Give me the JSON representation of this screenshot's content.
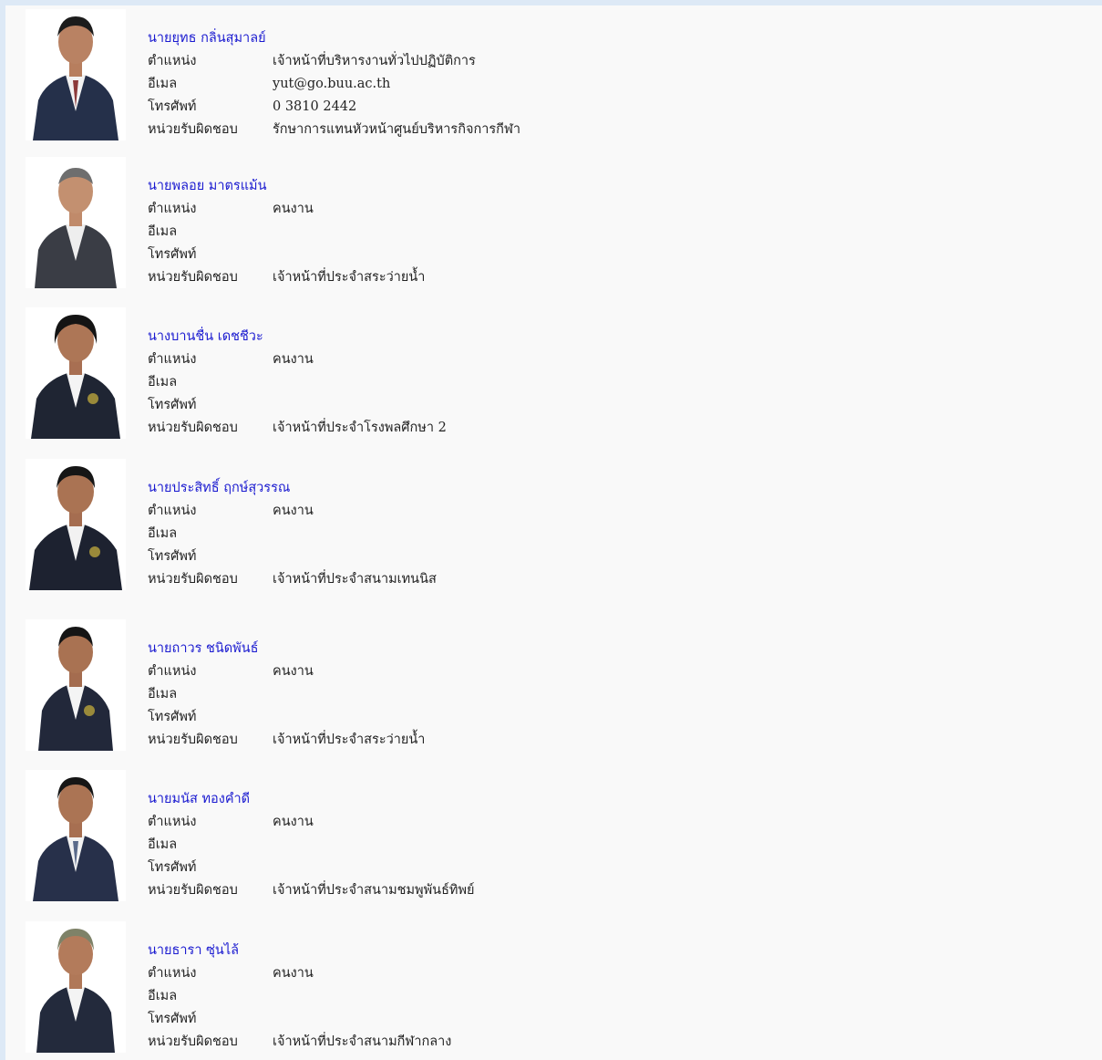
{
  "labels": {
    "position": "ตำแหน่ง",
    "email": "อีเมล",
    "phone": "โทรศัพท์",
    "unit": "หน่วยรับผิดชอบ"
  },
  "colors": {
    "name_link": "#1a1ad0",
    "text": "#222222",
    "page_bg": "#f9f9f9",
    "outer_bg": "#dde9f6",
    "suit": "#25304a"
  },
  "staff": [
    {
      "name": "นายยุทธ กลิ่นสุมาลย์",
      "position": "เจ้าหน้าที่บริหารงานทั่วไปปฏิบัติการ",
      "email": "yut@go.buu.ac.th",
      "phone": "0 3810 2442",
      "unit": "รักษาการแทนหัวหน้าศูนย์บริหารกิจการกีฬา",
      "photo_icon": "person-portrait-icon"
    },
    {
      "name": "นายพลอย มาตรแม้น",
      "position": "คนงาน",
      "email": "",
      "phone": "",
      "unit": "เจ้าหน้าที่ประจำสระว่ายน้ำ",
      "photo_icon": "person-portrait-icon"
    },
    {
      "name": "นางบานชื่น เดชชีวะ",
      "position": "คนงาน",
      "email": "",
      "phone": "",
      "unit": "เจ้าหน้าที่ประจำโรงพลศึกษา 2",
      "photo_icon": "person-portrait-icon"
    },
    {
      "name": "นายประสิทธิ์ ฤกษ์สุวรรณ",
      "position": "คนงาน",
      "email": "",
      "phone": "",
      "unit": "เจ้าหน้าที่ประจำสนามเทนนิส",
      "photo_icon": "person-portrait-icon"
    },
    {
      "name": "นายถาวร ชนิดพันธ์",
      "position": "คนงาน",
      "email": "",
      "phone": "",
      "unit": "เจ้าหน้าที่ประจำสระว่ายน้ำ",
      "photo_icon": "person-portrait-icon"
    },
    {
      "name": "นายมนัส ทองคำดี",
      "position": "คนงาน",
      "email": "",
      "phone": "",
      "unit": "เจ้าหน้าที่ประจำสนามชมพูพันธ์ทิพย์",
      "photo_icon": "person-portrait-icon"
    },
    {
      "name": "นายธารา ซุ่นไล้",
      "position": "คนงาน",
      "email": "",
      "phone": "",
      "unit": "เจ้าหน้าที่ประจำสนามกีฬากลาง",
      "photo_icon": "person-portrait-icon"
    }
  ]
}
